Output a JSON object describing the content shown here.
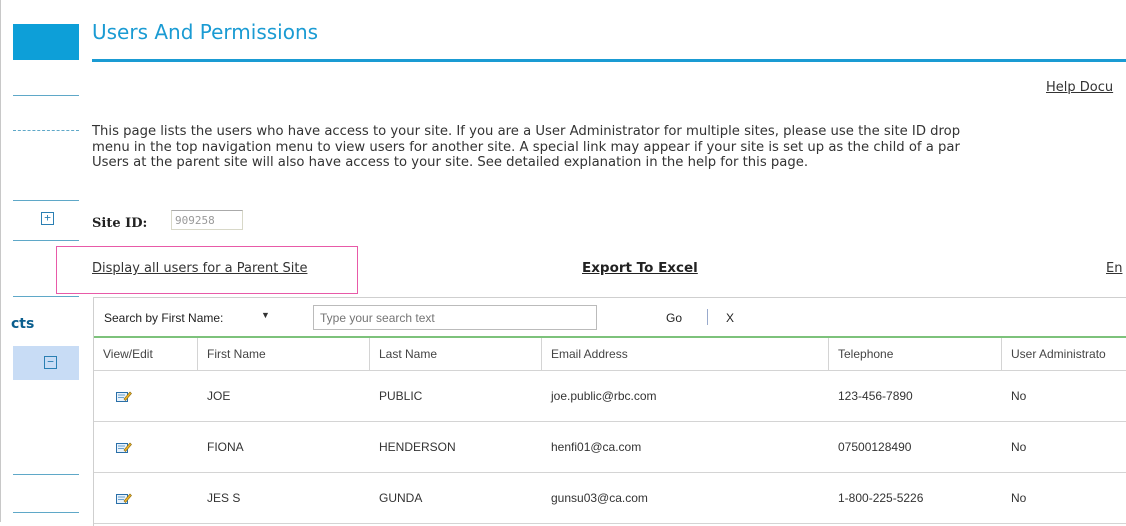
{
  "page": {
    "title": "Users And Permissions",
    "help_link": "Help Docu",
    "description": [
      "This page lists the users who have access to your site. If you are a User Administrator for multiple sites, please use the site ID drop",
      "menu in the top navigation menu to view users for another site. A special link may appear if your site is set up as the child of a par",
      "Users at the parent site will also have access to your site. See detailed explanation in the help for this page."
    ]
  },
  "sidebar": {
    "section_label": "cts",
    "expand_glyph": "+",
    "collapse_glyph": "−"
  },
  "site": {
    "label": "Site ID:",
    "value": "909258"
  },
  "actions": {
    "parent_link": "Display all users for a Parent Site",
    "export_link": "Export To Excel",
    "truncated_link": "En"
  },
  "search": {
    "field_label": "Search by First Name:",
    "caret": "▼",
    "placeholder": "Type your search text",
    "go_label": "Go",
    "clear_label": "X"
  },
  "table": {
    "columns": [
      "View/Edit",
      "First Name",
      "Last Name",
      "Email Address",
      "Telephone",
      "User Administrato"
    ],
    "rows": [
      {
        "first": "JOE",
        "last": "PUBLIC",
        "email": "joe.public@rbc.com",
        "phone": "123-456-7890",
        "admin": "No"
      },
      {
        "first": "FIONA",
        "last": "HENDERSON",
        "email": "henfi01@ca.com",
        "phone": "07500128490",
        "admin": "No"
      },
      {
        "first": "JES S",
        "last": "GUNDA",
        "email": "gunsu03@ca.com",
        "phone": "1-800-225-5226",
        "admin": "No"
      }
    ]
  },
  "icons": {
    "edit": "edit-icon"
  },
  "colors": {
    "accent": "#1a9bd3",
    "sidebar_block": "#0d9fd8",
    "highlight_box": "#e85aa8",
    "search_underline": "#7dc27b",
    "selected_item": "#c8dcf5"
  }
}
